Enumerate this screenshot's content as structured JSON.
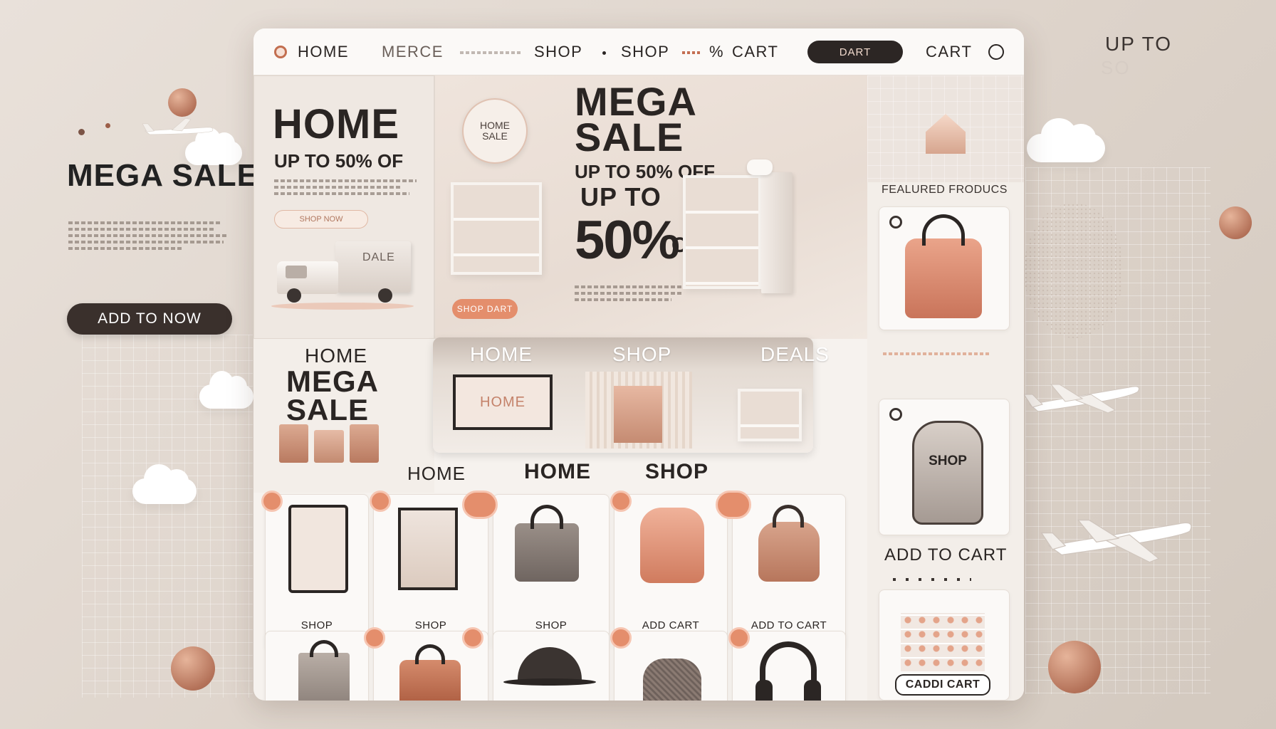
{
  "left": {
    "title": "MEGA SALE",
    "cta": "ADD TO NOW"
  },
  "top_right": {
    "line1": "UP TO",
    "line2": "SO"
  },
  "nav": {
    "items": [
      "HOME",
      "MERCE",
      "SHOP",
      "SHOP",
      "%",
      "CART"
    ],
    "pill": "DART",
    "cart": "CART"
  },
  "promo": {
    "title": "HOME",
    "subtitle": "UP TO 50% OF",
    "button": "SHOP NOW",
    "truck_text": "DALE"
  },
  "hero": {
    "sign": "HOME SALE",
    "title_line1": "MEGA",
    "title_line2": "SALE",
    "subtitle": "UP TO 50% OFF",
    "big_up": "UP TO",
    "big_num": "50%",
    "big_off": "OFF",
    "button": "SHOP DART"
  },
  "featured": {
    "title": "FEALURED FRODUCS"
  },
  "mid": {
    "home": "HOME",
    "mega": "MEGA",
    "sale": "SALE",
    "tabs": [
      "HOME",
      "SHOP",
      "DEALS"
    ],
    "tv": "HOME"
  },
  "section_tabs": [
    "HOME",
    "HOME",
    "SHOP"
  ],
  "products_row1": [
    {
      "label": "SHOP"
    },
    {
      "label": "SHOP"
    },
    {
      "label": "SHOP"
    },
    {
      "label": "ADD CART"
    },
    {
      "label": "ADD TO CART"
    }
  ],
  "right": {
    "bag_label": "SHOP",
    "add_to_cart": "ADD TO CART",
    "cart_button": "CADDI CART"
  },
  "colors": {
    "accent": "#e48e6c",
    "dark": "#2c2624",
    "background": "#e4dbd3"
  }
}
